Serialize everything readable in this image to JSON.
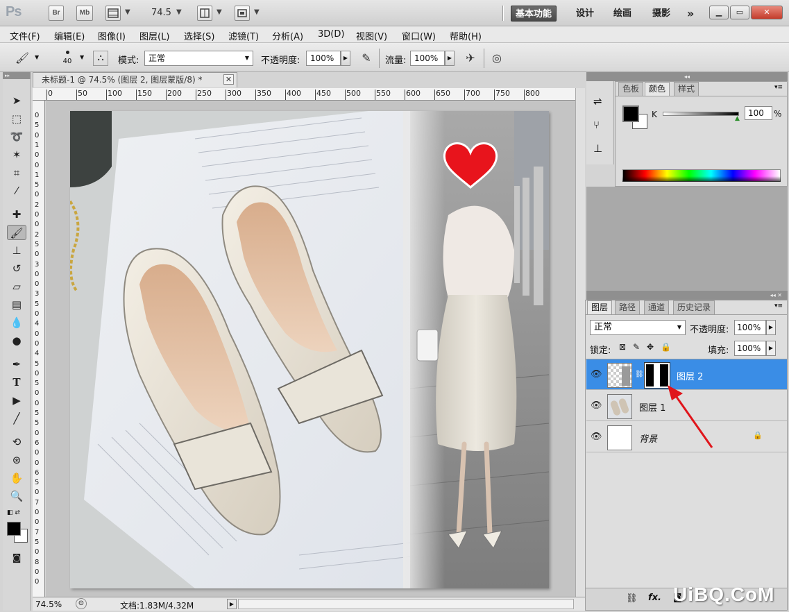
{
  "app": {
    "logo": "Ps",
    "bridge_label": "Br",
    "minibridge_label": "Mb",
    "zoom_value": "74.5"
  },
  "workspaces": [
    {
      "label": "基本功能",
      "active": true
    },
    {
      "label": "设计",
      "active": false
    },
    {
      "label": "绘画",
      "active": false
    },
    {
      "label": "摄影",
      "active": false
    }
  ],
  "workspace_more": "»",
  "menu": [
    "文件(F)",
    "编辑(E)",
    "图像(I)",
    "图层(L)",
    "选择(S)",
    "滤镜(T)",
    "分析(A)",
    "3D(D)",
    "视图(V)",
    "窗口(W)",
    "帮助(H)"
  ],
  "options": {
    "brush_size": "40",
    "mode_label": "模式:",
    "mode_value": "正常",
    "opacity_label": "不透明度:",
    "opacity_value": "100%",
    "flow_label": "流量:",
    "flow_value": "100%"
  },
  "document": {
    "tab_title": "未标题-1 @ 74.5% (图层 2, 图层蒙版/8) *",
    "ruler_top": [
      "0",
      "50",
      "100",
      "150",
      "200",
      "250",
      "300",
      "350",
      "400",
      "450",
      "500",
      "550",
      "600",
      "650",
      "700",
      "750",
      "800"
    ],
    "ruler_left": [
      "0",
      "5",
      "0",
      "1",
      "0",
      "0",
      "1",
      "5",
      "0",
      "2",
      "0",
      "0",
      "2",
      "5",
      "0",
      "3",
      "0",
      "0",
      "3",
      "5",
      "0",
      "4",
      "0",
      "0",
      "4",
      "5",
      "0",
      "5",
      "0",
      "0",
      "5",
      "5",
      "0",
      "6",
      "0",
      "0",
      "6",
      "5",
      "0",
      "7",
      "0",
      "0",
      "7",
      "5",
      "0",
      "8",
      "0",
      "0"
    ]
  },
  "status": {
    "zoom": "74.5%",
    "doc_info": "文档:1.83M/4.32M"
  },
  "color_panel": {
    "tabs": [
      {
        "label": "色板",
        "active": false
      },
      {
        "label": "颜色",
        "active": true
      },
      {
        "label": "样式",
        "active": false
      }
    ],
    "channel_label": "K",
    "channel_value": "100",
    "percent": "%"
  },
  "layers_panel": {
    "tabs": [
      {
        "label": "图层",
        "active": true
      },
      {
        "label": "路径",
        "active": false
      },
      {
        "label": "通道",
        "active": false
      },
      {
        "label": "历史记录",
        "active": false
      }
    ],
    "blend_mode": "正常",
    "opacity_label": "不透明度:",
    "opacity_value": "100%",
    "lock_label": "锁定:",
    "fill_label": "填充:",
    "fill_value": "100%",
    "layers": [
      {
        "name": "图层 2",
        "selected": true,
        "has_mask": true
      },
      {
        "name": "图层 1",
        "selected": false,
        "has_mask": false
      },
      {
        "name": "背景",
        "selected": false,
        "has_mask": false,
        "locked": true
      }
    ],
    "footer_fx": "fx."
  },
  "watermark": "UiBQ.CoM",
  "colors": {
    "selection_blue": "#3a8de6",
    "annotation_red": "#e0151b",
    "heart_red": "#e8141c"
  }
}
